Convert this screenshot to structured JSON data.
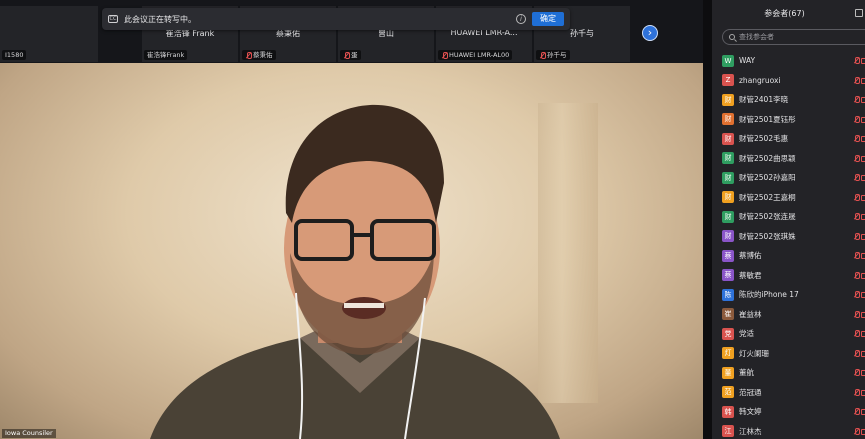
{
  "banner": {
    "text": "此会议正在转写中。",
    "ok_label": "确定"
  },
  "thumbnails": [
    {
      "name": "",
      "label": "I1580",
      "muted": false
    },
    {
      "name": "崔浩锋 Frank",
      "label": "崔浩锋Frank",
      "muted": false
    },
    {
      "name": "蔡秉佑",
      "label": "蔡秉佑",
      "muted": true
    },
    {
      "name": "曾山",
      "label": "蛋",
      "muted": true
    },
    {
      "name": "HUAWEI LMR-A...",
      "label": "HUAWEI LMR-AL00",
      "muted": true
    },
    {
      "name": "孙千与",
      "label": "孙千与",
      "muted": true
    }
  ],
  "next_label": "›",
  "speaker": {
    "label": "Iowa Counsiler"
  },
  "panel": {
    "title": "参会者(67)",
    "search_placeholder": "查找参会者",
    "participants": [
      {
        "initial": "W",
        "name": "WAY",
        "color": "#2f9e61"
      },
      {
        "initial": "Z",
        "name": "zhangruoxi",
        "color": "#d9534f"
      },
      {
        "initial": "财",
        "name": "财管2401李晓",
        "color": "#f0a020"
      },
      {
        "initial": "财",
        "name": "财管2501夏钰彤",
        "color": "#e07030"
      },
      {
        "initial": "财",
        "name": "财管2502毛惠",
        "color": "#d9534f"
      },
      {
        "initial": "财",
        "name": "财管2502曲思颖",
        "color": "#2f9e61"
      },
      {
        "initial": "财",
        "name": "财管2502孙嘉阳",
        "color": "#2f9e61"
      },
      {
        "initial": "财",
        "name": "财管2502王嘉桐",
        "color": "#f0a020"
      },
      {
        "initial": "财",
        "name": "财管2502张连晟",
        "color": "#2f9e61"
      },
      {
        "initial": "财",
        "name": "财管2502张琪姝",
        "color": "#8a55c8"
      },
      {
        "initial": "蔡",
        "name": "蔡博佑",
        "color": "#8a55c8"
      },
      {
        "initial": "蔡",
        "name": "蔡敏君",
        "color": "#8a55c8"
      },
      {
        "initial": "陈",
        "name": "陈欣的iPhone 17",
        "color": "#2e72da"
      },
      {
        "initial": "崔",
        "name": "崔益林",
        "color": "#8b5a3c"
      },
      {
        "initial": "党",
        "name": "党适",
        "color": "#d9534f"
      },
      {
        "initial": "灯",
        "name": "灯火阑珊",
        "color": "#f0a020"
      },
      {
        "initial": "董",
        "name": "董航",
        "color": "#f0a020"
      },
      {
        "initial": "范",
        "name": "范冠通",
        "color": "#f0a020"
      },
      {
        "initial": "韩",
        "name": "韩文婷",
        "color": "#d9534f"
      },
      {
        "initial": "江",
        "name": "江林杰",
        "color": "#d9534f"
      }
    ]
  }
}
